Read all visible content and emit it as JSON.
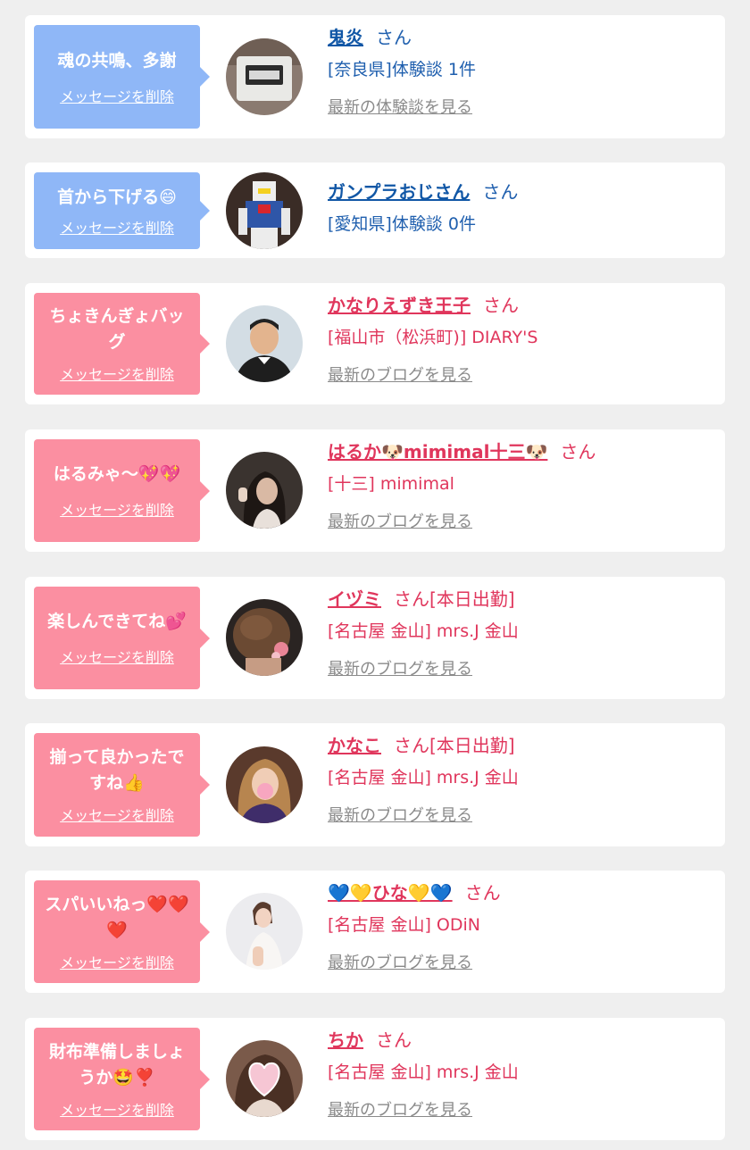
{
  "colors": {
    "bubble_blue": "#8fb7f7",
    "bubble_pink": "#fb8fa1",
    "text_blue": "#1f5fae",
    "text_pink": "#e0365c",
    "link_gray": "#8a8a8a",
    "background": "#efefef"
  },
  "items": [
    {
      "message": "魂の共鳴、多謝",
      "delete_label": "メッセージを削除",
      "avatar_icon": "clock-photo-avatar",
      "name": "鬼炎",
      "honorific": "さん",
      "location": "[奈良県]体験談 1件",
      "latest_link": "最新の体験談を見る",
      "theme": "blue"
    },
    {
      "message": "首から下げる😄",
      "delete_label": "メッセージを削除",
      "avatar_icon": "gundam-photo-avatar",
      "name": "ガンプラおじさん",
      "honorific": "さん",
      "location": "[愛知県]体験談 0件",
      "latest_link": "",
      "theme": "blue"
    },
    {
      "message": "ちょきんぎょバッグ",
      "delete_label": "メッセージを削除",
      "avatar_icon": "man-photo-avatar",
      "name": "かなりえずき王子",
      "honorific": "さん",
      "location": "[福山市（松浜町)] DIARY'S",
      "latest_link": "最新のブログを見る",
      "theme": "pink"
    },
    {
      "message": "はるみゃ〜💖💖",
      "delete_label": "メッセージを削除",
      "avatar_icon": "woman-photo-avatar",
      "name": "はるか🐶mimimal十三🐶",
      "honorific": "さん",
      "location": "[十三] mimimal",
      "latest_link": "最新のブログを見る",
      "theme": "pink"
    },
    {
      "message": "楽しんできてね💕",
      "delete_label": "メッセージを削除",
      "avatar_icon": "hair-photo-avatar",
      "name": "イヅミ",
      "honorific": "さん[本日出勤]",
      "location": "[名古屋 金山] mrs.J 金山",
      "latest_link": "最新のブログを見る",
      "theme": "pink"
    },
    {
      "message": "揃って良かったですね👍",
      "delete_label": "メッセージを削除",
      "avatar_icon": "woman-photo-avatar",
      "name": "かなこ",
      "honorific": "さん[本日出勤]",
      "location": "[名古屋 金山] mrs.J 金山",
      "latest_link": "最新のブログを見る",
      "theme": "pink"
    },
    {
      "message": "スパいいねっ❤️❤️❤️",
      "delete_label": "メッセージを削除",
      "avatar_icon": "woman-photo-avatar",
      "name": "💙💛ひな💛💙",
      "honorific": "さん",
      "location": "[名古屋 金山] ODiN",
      "latest_link": "最新のブログを見る",
      "theme": "pink"
    },
    {
      "message": "財布準備しましょうか🤩❣️",
      "delete_label": "メッセージを削除",
      "avatar_icon": "heart-sticker-photo-avatar",
      "name": "ちか",
      "honorific": "さん",
      "location": "[名古屋 金山] mrs.J 金山",
      "latest_link": "最新のブログを見る",
      "theme": "pink"
    }
  ]
}
